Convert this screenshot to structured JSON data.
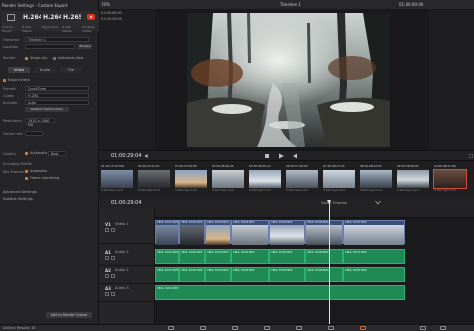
{
  "left": {
    "title": "Render Settings - Custom Export",
    "presets": [
      {
        "big": "",
        "sub": "Custom Export"
      },
      {
        "big": "H.264",
        "sub": "H.264 Master"
      },
      {
        "big": "H.264",
        "sub": "Hyperdeck"
      },
      {
        "big": "H.265",
        "sub": "H.265 Master"
      },
      {
        "big": "",
        "sub": "YouTube 1080p"
      }
    ],
    "filename_label": "Filename",
    "filename_value": "Timeline 1",
    "location_label": "Location",
    "location_value": "",
    "browse_label": "Browse",
    "render_label": "Render",
    "single_clip": "Single clip",
    "individual_clips": "Individual clips",
    "tabs": [
      "Video",
      "Audio",
      "File"
    ],
    "export_video_label": "Export Video",
    "format_label": "Format",
    "format_value": "QuickTime",
    "codec_label": "Codec",
    "codec_value": "H.264",
    "encoder_label": "Encoder",
    "encoder_value": "Auto",
    "network_opt": "Network Optimization",
    "resolution_label": "Resolution",
    "resolution_value": "1920 x 1080 HD",
    "frame_rate_label": "Frame rate",
    "quality_label": "Quality",
    "quality_value": "Automatic",
    "quality_value2": "Best",
    "encoding_label": "Encoding Profile",
    "keyframes_label": "Key Frames",
    "keyframes_value": "Automatic",
    "frame_reorder": "Frame reordering",
    "advanced_label": "Advanced Settings",
    "subtitle_label": "Subtitle Settings",
    "add_queue": "Add to Render Queue"
  },
  "header": {
    "zoom": "70%",
    "timeline_name": "Timeline 1",
    "tc_left": "01:00:00:00",
    "tc_left2": "01:00:29:04",
    "tc_right": "01:00:00:00"
  },
  "viewer": {
    "timecode": "01:00:29:04"
  },
  "thumbs": [
    {
      "lbl": "01",
      "tc": "00:13:10:024",
      "cap": "H.264 High 4:2:0"
    },
    {
      "lbl": "02",
      "tc": "00:13:11:07",
      "cap": "H.264 High 4:2:0"
    },
    {
      "lbl": "03",
      "tc": "00:13:09:08",
      "cap": "H.264 High 4:2:0"
    },
    {
      "lbl": "04",
      "tc": "00:08:26:44",
      "cap": "H.264 High 4:2:0"
    },
    {
      "lbl": "05",
      "tc": "00:08:20:12",
      "cap": "H.264 High 4:2:0"
    },
    {
      "lbl": "06",
      "tc": "00:17:20:00",
      "cap": "H.264 High 4:2:0"
    },
    {
      "lbl": "07",
      "tc": "00:08:17:23",
      "cap": "H.264 High 4:2:0"
    },
    {
      "lbl": "08",
      "tc": "00:08:42:03",
      "cap": "H.264 High 4:2:0"
    },
    {
      "lbl": "09",
      "tc": "00:08:58:00",
      "cap": "H.264 High 4:2:0"
    },
    {
      "lbl": "10",
      "tc": "00:08:21:06",
      "cap": "H.264 High 4:2:0"
    }
  ],
  "timeline": {
    "timecode": "01:00:29:04",
    "select_label": "Select Timeline",
    "tracks": [
      {
        "id": "V1",
        "name": "Video 1"
      },
      {
        "id": "A1",
        "name": "Audio 1"
      },
      {
        "id": "A2",
        "name": "Audio 2"
      },
      {
        "id": "A3",
        "name": "Audio 3"
      }
    ],
    "vclip_labels": [
      "CBUL DCD1.MP4",
      "CBUL DCD2.MP4",
      "CBUL DCD3.MP4",
      "CBUL DCD4.MP4",
      "CBUL DCD5.MP4",
      "CBUL DCD6.MP4",
      "CBUL DCD7.MP4"
    ],
    "aclip_labels": [
      "CBUL DCD1.MP4",
      "CBUL DCD2.MP4",
      "CBUL DCD3.MP4",
      "CBUL DCD4.MP4",
      "CBUL DCD5.MP4",
      "CBUL DCD6.MP4",
      "CBUL DCD7.MP4"
    ]
  },
  "bottom": {
    "app_label": "DaVinci Resolve 16"
  }
}
